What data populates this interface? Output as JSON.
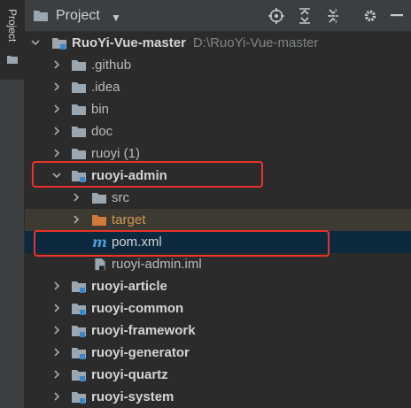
{
  "sidebar": {
    "tab_label": "Project"
  },
  "toolbar": {
    "title": "Project",
    "buttons": [
      "locate-icon",
      "expand-all-icon",
      "collapse-all-icon",
      "gear-icon",
      "minimize-icon"
    ]
  },
  "tree": {
    "root": {
      "name": "RuoYi-Vue-master",
      "path": "D:\\RuoYi-Vue-master"
    },
    "items": [
      {
        "label": ".github",
        "kind": "folder"
      },
      {
        "label": ".idea",
        "kind": "folder"
      },
      {
        "label": "bin",
        "kind": "folder"
      },
      {
        "label": "doc",
        "kind": "folder"
      },
      {
        "label": "ruoyi (1)",
        "kind": "folder"
      },
      {
        "label": "ruoyi-admin",
        "kind": "module",
        "expanded": true
      },
      {
        "label": "src",
        "kind": "folder"
      },
      {
        "label": "target",
        "kind": "excluded-folder"
      },
      {
        "label": "pom.xml",
        "kind": "maven-file",
        "selected": true
      },
      {
        "label": "ruoyi-admin.iml",
        "kind": "iml-file"
      },
      {
        "label": "ruoyi-article",
        "kind": "module"
      },
      {
        "label": "ruoyi-common",
        "kind": "module"
      },
      {
        "label": "ruoyi-framework",
        "kind": "module"
      },
      {
        "label": "ruoyi-generator",
        "kind": "module"
      },
      {
        "label": "ruoyi-quartz",
        "kind": "module"
      },
      {
        "label": "ruoyi-system",
        "kind": "module"
      }
    ]
  },
  "colors": {
    "selection": "#0d293e",
    "excluded_row": "#3d3a32",
    "highlight_box": "#e8322b",
    "maven_icon": "#4e9bd9"
  }
}
